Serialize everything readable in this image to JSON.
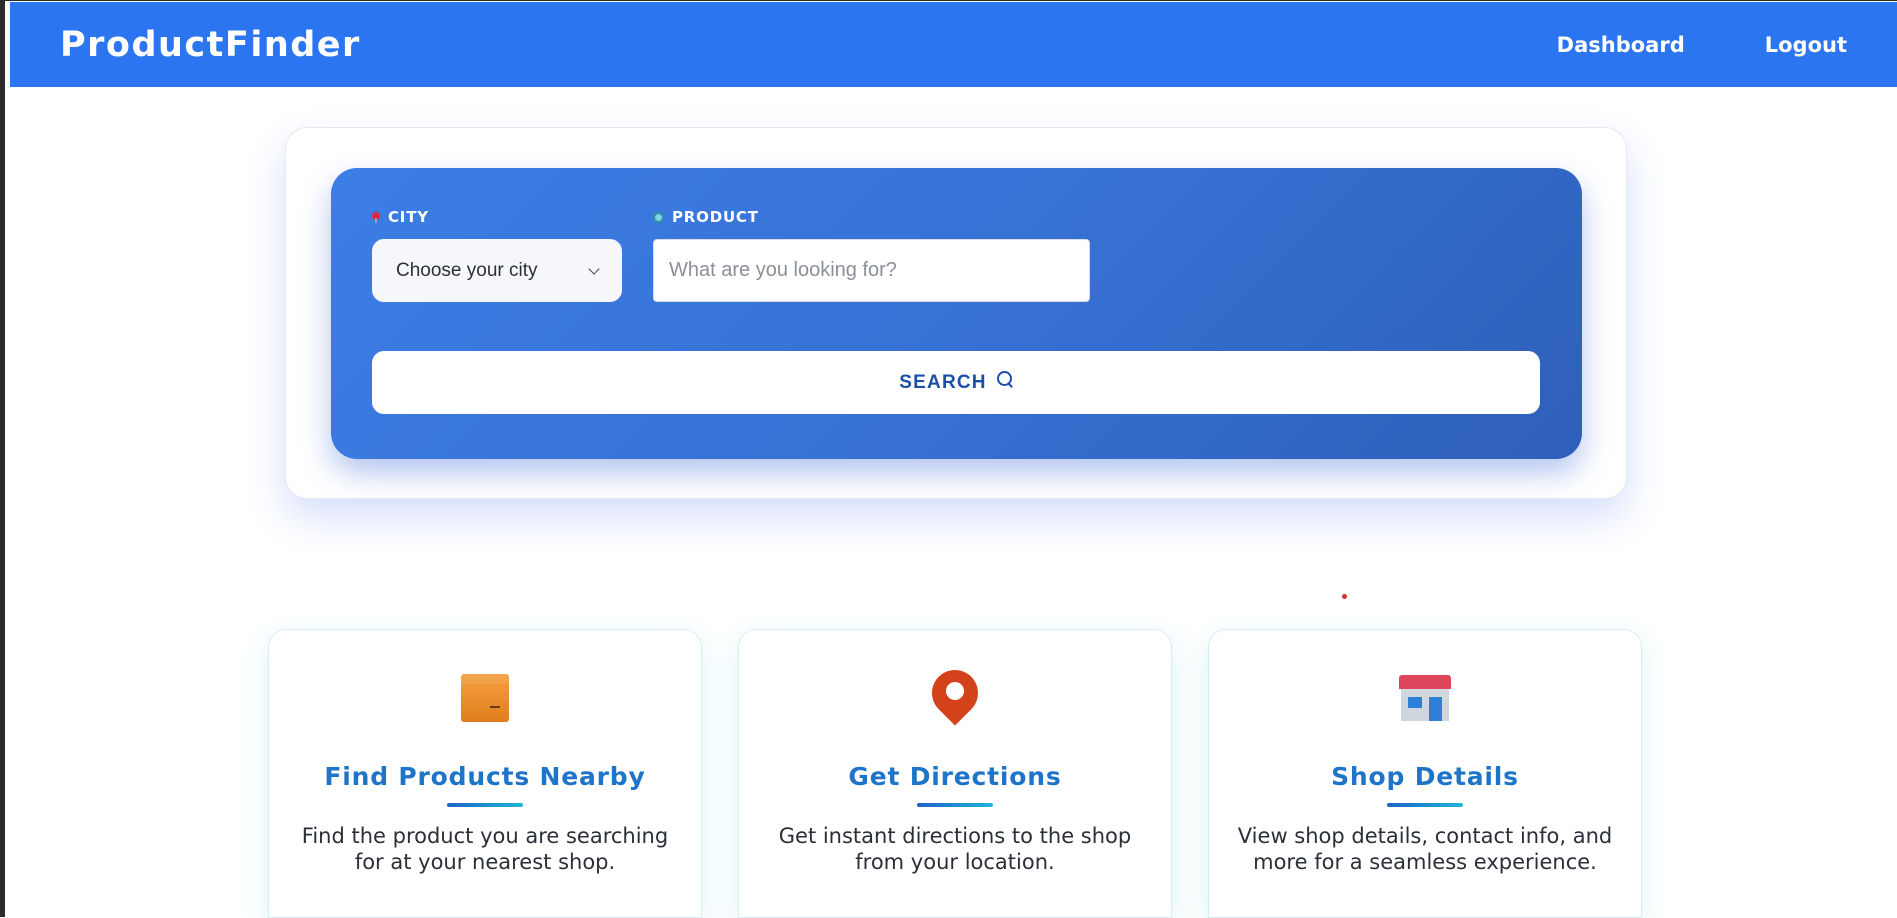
{
  "navbar": {
    "brand": "ProductFinder",
    "links": [
      "Dashboard",
      "Logout"
    ],
    "background": "#2b76f0"
  },
  "search": {
    "city_label": "CITY",
    "city_value": "Choose your city",
    "product_label": "PRODUCT",
    "product_placeholder": "What are you looking for?",
    "search_button": "SEARCH",
    "panel_color": "#3670d2"
  },
  "features": [
    {
      "icon": "package-icon",
      "title": "Find Products Nearby",
      "desc": "Find the product you are searching for at your nearest shop."
    },
    {
      "icon": "map-pin-icon",
      "title": "Get Directions",
      "desc": "Get instant directions to the shop from your location."
    },
    {
      "icon": "shop-icon",
      "title": "Shop Details",
      "desc": "View shop details, contact info, and more for a seamless experience."
    }
  ],
  "colors": {
    "title_blue": "#1d74c9",
    "button_text": "#1d4fa8"
  }
}
